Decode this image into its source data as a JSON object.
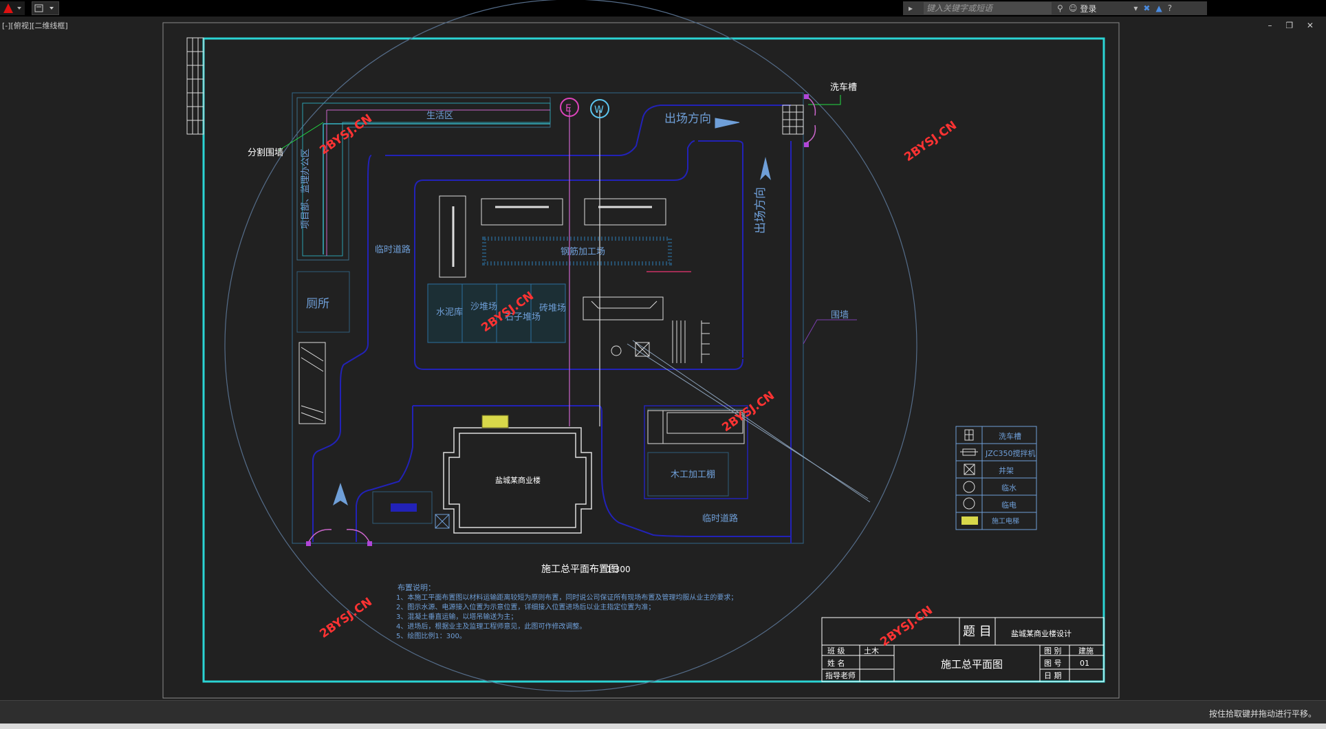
{
  "app": {
    "search_placeholder": "键入关键字或短语",
    "login_label": "登录",
    "viewport_label": "[-][俯视][二维线框]",
    "window_controls": "–  ❐  ✕",
    "status_message": "按住拾取键并拖动进行平移。"
  },
  "colors": {
    "background": "#212121",
    "frame": "#2bd4d4",
    "road": "#2222b8",
    "text_blue": "#6f9fd8",
    "title_white": "#ffffff"
  },
  "drawing": {
    "labels": {
      "living_area": "生活区",
      "office": "项目部、监理办公区",
      "partition_wall": "分割围墙",
      "temp_road_1": "临时道路",
      "temp_road_2": "临时道路",
      "toilet": "厕所",
      "steel_shop": "钢筋加工场",
      "cement": "水泥库",
      "sand": "沙堆场",
      "stone": "石子堆场",
      "brick": "砖堆场",
      "exit_direction_1": "出场方向",
      "exit_direction_2": "出场方向",
      "car_wash": "洗车槽",
      "enclosure": "围墙",
      "building": "盐城某商业楼",
      "wood_shop": "木工加工棚",
      "power_mark": "E",
      "water_mark": "W"
    },
    "plan_title": "施工总平面布置图",
    "plan_scale": "1:300",
    "notes_title": "布置说明：",
    "notes": [
      "1、本施工平面布置图以材料运输距离较短为原则布置，同时说公司保证所有现场布置及管理均服从业主的要求；",
      "2、图示水源、电源接入位置为示意位置，详细接入位置进场后以业主指定位置为准；",
      "3、混凝土垂直运输，以塔吊输送为主；",
      "4、进场后，根据业主及监理工程师意见，此图可作修改调整。",
      "5、绘图比例1：300。"
    ],
    "watermark": "2BYSJ.CN"
  },
  "legend": [
    {
      "icon": "grid-icon",
      "label": "洗车槽"
    },
    {
      "icon": "mixer-icon",
      "label": "JZC350搅拌机"
    },
    {
      "icon": "cross-box-icon",
      "label": "井架"
    },
    {
      "icon": "water-icon",
      "label": "临水"
    },
    {
      "icon": "power-icon",
      "label": "临电"
    },
    {
      "icon": "tower-icon",
      "label": "施工电梯"
    }
  ],
  "title_block": {
    "heading": "题  目",
    "project": "盐城某商业楼设计",
    "drawing_name": "施工总平面图",
    "class_label": "班  级",
    "class_value": "土木",
    "name_label": "姓  名",
    "advisor_label": "指导老师",
    "category_label": "图  别",
    "category_value": "建施",
    "number_label": "图  号",
    "number_value": "01",
    "date_label": "日  期"
  }
}
